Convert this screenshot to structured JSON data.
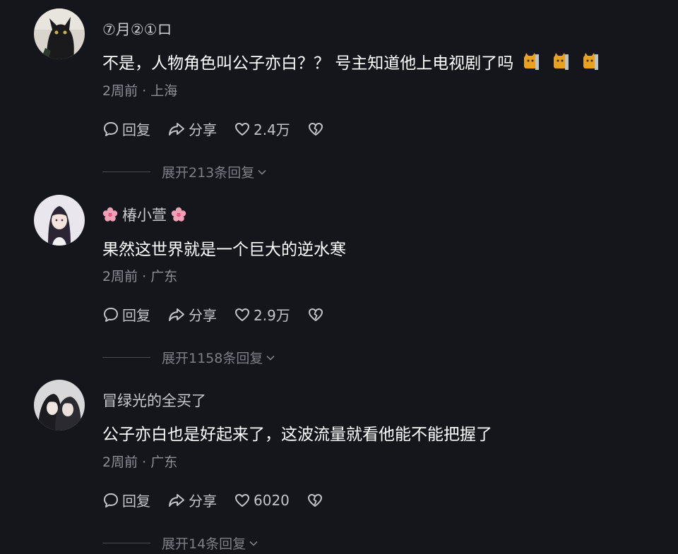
{
  "comments": [
    {
      "username": "⑦月②①ロ",
      "text": "不是，人物角色叫公子亦白？？ 号主知道他上电视剧了吗",
      "emojis": [
        "cat-sticker-icon",
        "cat-sticker-icon",
        "cat-sticker-icon"
      ],
      "meta": "2周前 · 上海",
      "reply_label": "回复",
      "share_label": "分享",
      "likes": "2.4万",
      "expand_label": "展开213条回复"
    },
    {
      "username": "椿小萱",
      "text": "果然这世界就是一个巨大的逆水寒",
      "meta": "2周前 · 广东",
      "reply_label": "回复",
      "share_label": "分享",
      "likes": "2.9万",
      "expand_label": "展开1158条回复"
    },
    {
      "username": "冒绿光的全买了",
      "text": "公子亦白也是好起来了，这波流量就看他能不能把握了",
      "meta": "2周前 · 广东",
      "reply_label": "回复",
      "share_label": "分享",
      "likes": "6020",
      "expand_label": "展开14条回复"
    }
  ],
  "colors": {
    "background": "#15161c",
    "text": "#ffffff",
    "username": "#c9cad0",
    "meta": "#8e8f97",
    "action": "#c4c5cc"
  }
}
